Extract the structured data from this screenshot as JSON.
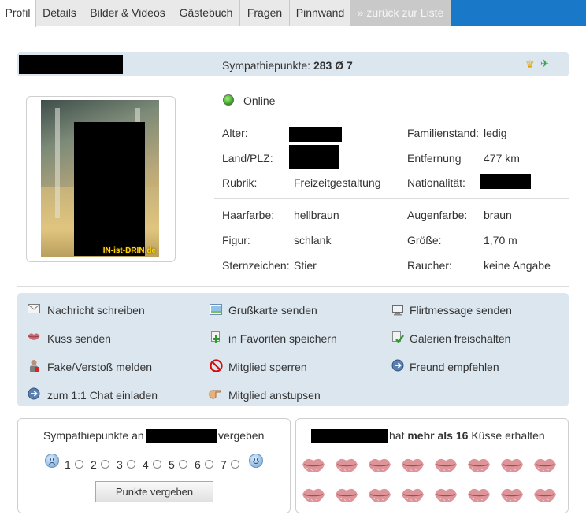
{
  "tabs": [
    {
      "label": "Profil"
    },
    {
      "label": "Details"
    },
    {
      "label": "Bilder & Videos"
    },
    {
      "label": "Gästebuch"
    },
    {
      "label": "Fragen"
    },
    {
      "label": "Pinnwand"
    },
    {
      "label": "» zurück zur Liste"
    }
  ],
  "header": {
    "sympathy_label": "Sympathiepunkte:",
    "points": "283",
    "avg": "Ø 7"
  },
  "photo": {
    "watermark": "IN-ist-DRIN.de"
  },
  "status": {
    "online": "Online"
  },
  "details": {
    "alter_label": "Alter:",
    "land_label": "Land/PLZ:",
    "rubrik_label": "Rubrik:",
    "rubrik_value": "Freizeitgestaltung",
    "familienstand_label": "Familienstand:",
    "familienstand_value": "ledig",
    "entfernung_label": "Entfernung",
    "entfernung_value": "477 km",
    "nationalitaet_label": "Nationalität:",
    "haarfarbe_label": "Haarfarbe:",
    "haarfarbe_value": "hellbraun",
    "figur_label": "Figur:",
    "figur_value": "schlank",
    "sternzeichen_label": "Sternzeichen:",
    "sternzeichen_value": "Stier",
    "augenfarbe_label": "Augenfarbe:",
    "augenfarbe_value": "braun",
    "groesse_label": "Größe:",
    "groesse_value": "1,70 m",
    "raucher_label": "Raucher:",
    "raucher_value": "keine Angabe"
  },
  "actions": {
    "nachricht": "Nachricht schreiben",
    "grusskarte": "Grußkarte senden",
    "flirt": "Flirtmessage senden",
    "kuss": "Kuss senden",
    "favoriten": "in Favoriten speichern",
    "galerien": "Galerien freischalten",
    "fake": "Fake/Verstoß melden",
    "sperren": "Mitglied sperren",
    "empfehlen": "Freund empfehlen",
    "chat": "zum 1:1 Chat einladen",
    "anstupsen": "Mitglied anstupsen"
  },
  "vote": {
    "title_prefix": "Sympathiepunkte an",
    "title_suffix": "vergeben",
    "options": [
      "1",
      "2",
      "3",
      "4",
      "5",
      "6",
      "7"
    ],
    "button": "Punkte vergeben"
  },
  "kisses": {
    "prefix": "hat",
    "bold": "mehr als 16",
    "suffix": "Küsse erhalten",
    "count": 16
  }
}
